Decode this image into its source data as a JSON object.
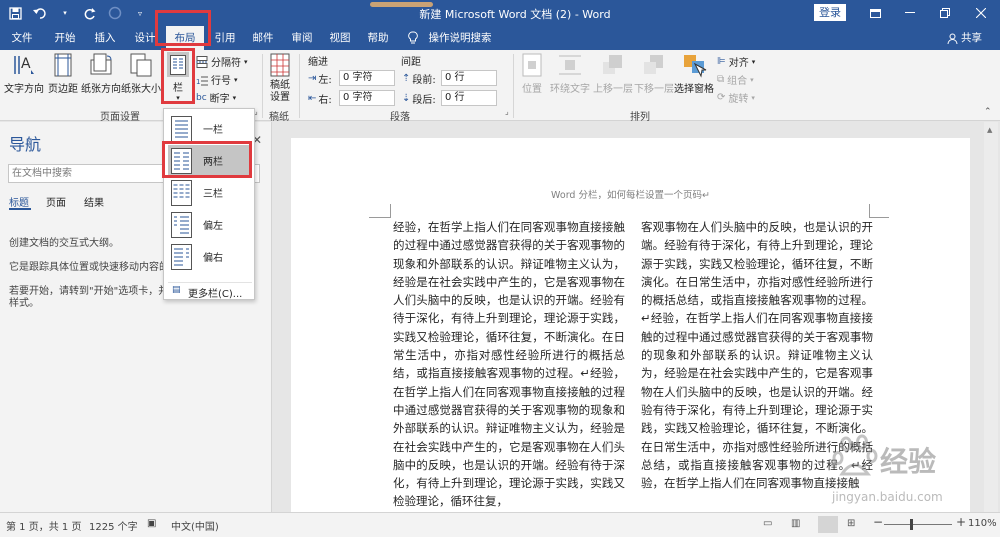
{
  "app": {
    "title": "新建 Microsoft Word 文档 (2)  -  Word",
    "login": "登录",
    "share": "共享",
    "colors": {
      "brand": "#2b579a",
      "highlight": "#e03a3e",
      "selection": "#c5c5c5"
    }
  },
  "qat": {
    "icons": [
      "save-icon",
      "undo-icon",
      "redo-icon",
      "circle-icon",
      "customize-icon"
    ]
  },
  "tabs": [
    "文件",
    "开始",
    "插入",
    "设计",
    "布局",
    "引用",
    "邮件",
    "审阅",
    "视图",
    "帮助"
  ],
  "tell_me": "操作说明搜索",
  "ribbon": {
    "page_setup": {
      "text_direction": "文字方向",
      "margins": "页边距",
      "orientation": "纸张方向",
      "size": "纸张大小",
      "columns": "栏",
      "breaks": "分隔符",
      "line_numbers": "行号",
      "hyphenation": "断字",
      "group_label": "页面设置"
    },
    "manuscript": {
      "setting": "稿纸\n设置",
      "group_label": "稿纸"
    },
    "paragraph": {
      "indent_header": "缩进",
      "spacing_header": "间距",
      "left_label": "左:",
      "left_value": "0 字符",
      "right_label": "右:",
      "right_value": "0 字符",
      "before_label": "段前:",
      "before_value": "0 行",
      "after_label": "段后:",
      "after_value": "0 行",
      "group_label": "段落"
    },
    "arrange": {
      "position": "位置",
      "wrap_text": "环绕文字",
      "bring_forward": "上移一层",
      "send_backward": "下移一层",
      "selection_pane": "选择窗格",
      "align": "对齐",
      "group": "组合",
      "rotate": "旋转",
      "group_label": "排列"
    }
  },
  "columns_menu": {
    "items": [
      "一栏",
      "两栏",
      "三栏",
      "偏左",
      "偏右"
    ],
    "selected": "两栏",
    "more": "更多栏(C)..."
  },
  "nav": {
    "title": "导航",
    "search_placeholder": "在文档中搜索",
    "tabs": [
      "标题",
      "页面",
      "结果"
    ],
    "line1": "创建文档的交互式大纲。",
    "line2": "它是跟踪具体位置或快速移动内容的",
    "line3": "若要开始，请转到\"开始\"选项卡，并向",
    "line4": "样式。"
  },
  "document": {
    "header": "Word 分栏，如何每栏设置一个页码↵",
    "col_left": "经验，在哲学上指人们在同客观事物直接接触的过程中通过感觉器官获得的关于客观事物的现象和外部联系的认识。辩证唯物主义认为，经验是在社会实践中产生的，它是客观事物在人们头脑中的反映，也是认识的开端。经验有待于深化，有待上升到理论，理论源于实践，实践又检验理论，循环往复，不断演化。在日常生活中，亦指对感性经验所进行的概括总结，或指直接接触客观事物的过程。↵经验，在哲学上指人们在同客观事物直接接触的过程中通过感觉器官获得的关于客观事物的现象和外部联系的认识。辩证唯物主义认为，经验是在社会实践中产生的，它是客观事物在人们头脑中的反映，也是认识的开端。经验有待于深化，有待上升到理论，理论源于实践，实践又检验理论，循环往复，",
    "col_right": "客观事物在人们头脑中的反映，也是认识的开端。经验有待于深化，有待上升到理论，理论源于实践，实践又检验理论，循环往复，不断演化。在日常生活中，亦指对感性经验所进行的概括总结，或指直接接触客观事物的过程。↵经验，在哲学上指人们在同客观事物直接接触的过程中通过感觉器官获得的关于客观事物的现象和外部联系的认识。辩证唯物主义认为，经验是在社会实践中产生的，它是客观事物在人们头脑中的反映，也是认识的开端。经验有待于深化，有待上升到理论，理论源于实践，实践又检验理论，循环往复，不断演化。在日常生活中，亦指对感性经验所进行的概括总结，或指直接接触客观事物的过程。↵经验，在哲学上指人们在同客观事物直接接触"
  },
  "status": {
    "page": "第 1 页，共 1 页",
    "words": "1225 个字",
    "language": "中文(中国)",
    "zoom": "110%"
  },
  "watermark": {
    "brand": "经验",
    "url": "jingyan.baidu.com"
  }
}
